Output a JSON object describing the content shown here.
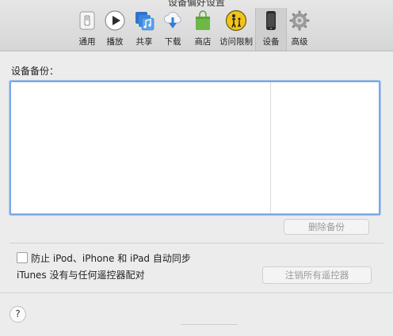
{
  "window": {
    "title": "设备偏好设置"
  },
  "toolbar": {
    "items": [
      {
        "label": "通用",
        "icon": "general-switch-icon"
      },
      {
        "label": "播放",
        "icon": "play-icon"
      },
      {
        "label": "共享",
        "icon": "share-music-icon"
      },
      {
        "label": "下载",
        "icon": "download-cloud-icon"
      },
      {
        "label": "商店",
        "icon": "store-bag-icon"
      },
      {
        "label": "访问限制",
        "icon": "parental-controls-icon"
      },
      {
        "label": "设备",
        "icon": "device-phone-icon",
        "active": true
      },
      {
        "label": "高级",
        "icon": "gear-icon"
      }
    ]
  },
  "backups": {
    "label": "设备备份：",
    "rows": [],
    "delete_button": "删除备份"
  },
  "sync": {
    "checkbox_label": "防止 iPod、iPhone 和 iPad 自动同步",
    "checked": false
  },
  "remotes": {
    "status": "iTunes 没有与任何遥控器配对",
    "unpair_button": "注销所有遥控器"
  },
  "help": {
    "label": "?"
  },
  "colors": {
    "accent": "#7aa7e6",
    "window_bg": "#ececec"
  }
}
